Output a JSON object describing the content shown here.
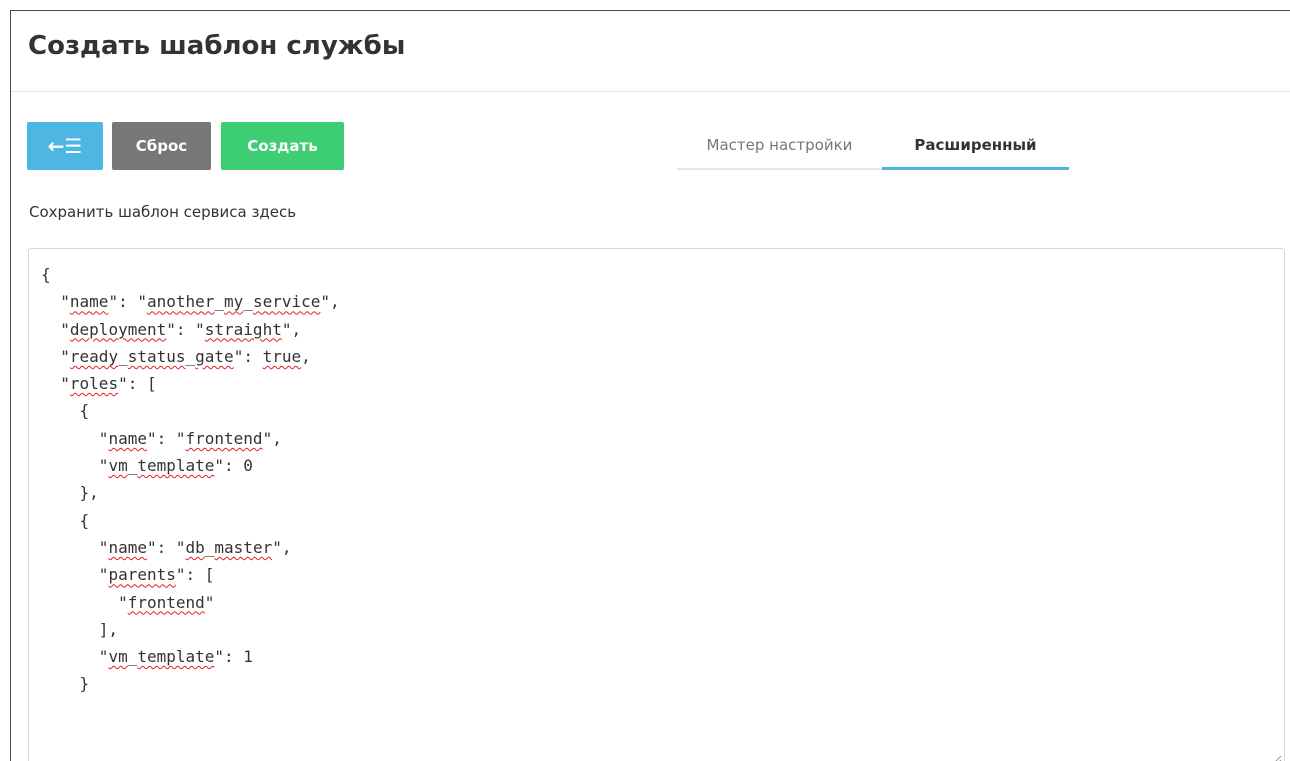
{
  "page": {
    "title": "Создать шаблон службы"
  },
  "toolbar": {
    "back_icon": "←☰",
    "reset_label": "Сброс",
    "create_label": "Создать"
  },
  "tabs": {
    "wizard_label": "Мастер настройки",
    "advanced_label": "Расширенный",
    "active": "advanced"
  },
  "helper_text": "Сохранить шаблон сервиса здесь",
  "editor": {
    "content": "{\n  \"name\": \"another_my_service\",\n  \"deployment\": \"straight\",\n  \"ready_status_gate\": true,\n  \"roles\": [\n    {\n      \"name\": \"frontend\",\n      \"vm_template\": 0\n    },\n    {\n      \"name\": \"db_master\",\n      \"parents\": [\n        \"frontend\"\n      ],\n      \"vm_template\": 1\n    }"
  },
  "colors": {
    "back_button": "#4db6e2",
    "reset_button": "#777777",
    "create_button": "#3dce74",
    "active_tab_underline": "#4db6e2",
    "spellcheck_underline": "#e02020"
  },
  "icons": {
    "back": "back-to-list-icon",
    "resize": "resize-handle-icon"
  }
}
